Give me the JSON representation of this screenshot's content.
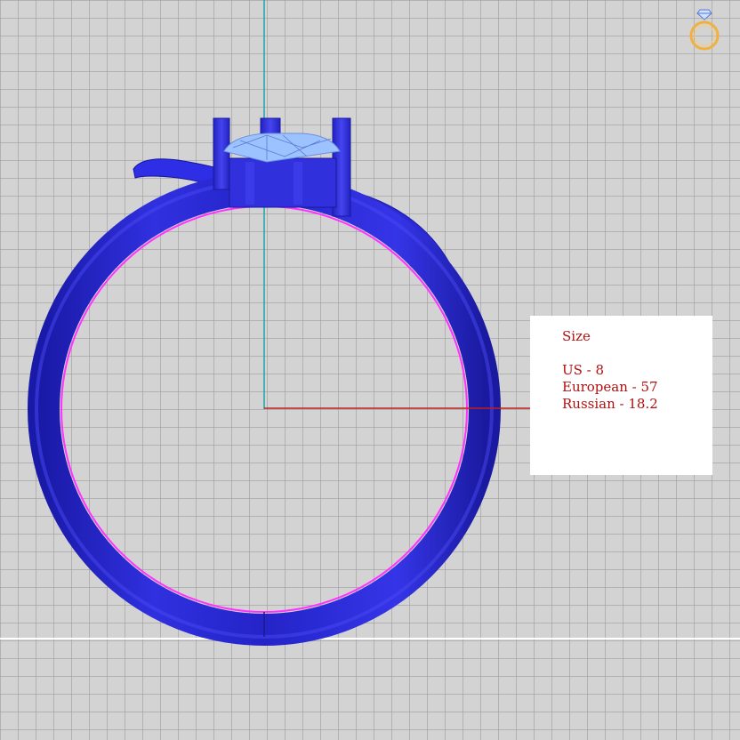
{
  "viewport": {
    "background_color": "#d3d3d3",
    "grid_color": "#9a9a9a",
    "axis_vertical_color": "#1aa6a6",
    "axis_horizontal_color": "#c0201a",
    "floor_line_color": "#ffffff"
  },
  "model": {
    "ring_color": "#2a2ad8",
    "inner_outline_color": "#ff33ff",
    "gem_color": "#8fb8ff"
  },
  "size_panel": {
    "title": "Size",
    "us": "US - 8",
    "european": "European - 57",
    "russian": "Russian - 18.2",
    "text_color": "#b01010"
  },
  "badge": {
    "icon": "ring-icon",
    "color": "#f2b040"
  }
}
